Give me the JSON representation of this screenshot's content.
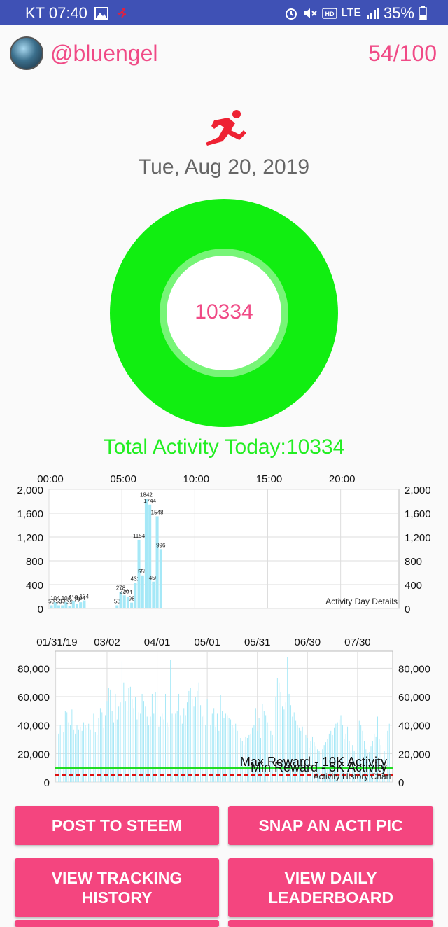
{
  "status_bar": {
    "carrier_time": "KT 07:40",
    "network": "LTE",
    "battery": "35%"
  },
  "header": {
    "username": "@bluengel",
    "score": "54/100"
  },
  "date": "Tue, Aug 20, 2019",
  "ring_value": "10334",
  "total_activity": "Total Activity Today:10334",
  "colors": {
    "accent": "#f4457f",
    "ring": "#11ee11",
    "status_bar": "#3f51b5",
    "bar": "#a5e8f7"
  },
  "chart_data": [
    {
      "type": "bar",
      "title": "Activity Day Details",
      "x_tick_labels": [
        "00:00",
        "05:00",
        "10:00",
        "15:00",
        "20:00"
      ],
      "x_ticks": [
        0,
        5,
        10,
        15,
        20
      ],
      "xlim": [
        0,
        24
      ],
      "y_ticks": [
        0,
        400,
        800,
        1200,
        1600,
        2000
      ],
      "y_tick_labels": [
        "0",
        "400",
        "800",
        "1,200",
        "1,600",
        "2,000"
      ],
      "ylim": [
        0,
        2000
      ],
      "grid": true,
      "bars": [
        {
          "x": 0.17,
          "v": 53,
          "label": "53"
        },
        {
          "x": 0.42,
          "v": 104,
          "label": "104"
        },
        {
          "x": 0.67,
          "v": 53,
          "label": "53"
        },
        {
          "x": 0.92,
          "v": 53,
          "label": "53"
        },
        {
          "x": 1.17,
          "v": 104,
          "label": "104"
        },
        {
          "x": 1.42,
          "v": 39,
          "label": "39"
        },
        {
          "x": 1.67,
          "v": 118,
          "label": "118"
        },
        {
          "x": 1.92,
          "v": 79,
          "label": "79"
        },
        {
          "x": 2.17,
          "v": 104,
          "label": "104"
        },
        {
          "x": 2.42,
          "v": 134,
          "label": "134"
        },
        {
          "x": 4.67,
          "v": 53,
          "label": "53"
        },
        {
          "x": 4.92,
          "v": 278,
          "label": "278"
        },
        {
          "x": 5.17,
          "v": 220,
          "label": "220"
        },
        {
          "x": 5.42,
          "v": 201,
          "label": "201"
        },
        {
          "x": 5.67,
          "v": 98,
          "label": "98"
        },
        {
          "x": 5.92,
          "v": 432,
          "label": "432"
        },
        {
          "x": 6.17,
          "v": 1154,
          "label": "1154"
        },
        {
          "x": 6.42,
          "v": 555,
          "label": "555"
        },
        {
          "x": 6.67,
          "v": 1842,
          "label": "1842"
        },
        {
          "x": 6.92,
          "v": 1744,
          "label": "1744"
        },
        {
          "x": 7.17,
          "v": 450,
          "label": "450"
        },
        {
          "x": 7.42,
          "v": 1548,
          "label": "1548"
        },
        {
          "x": 7.67,
          "v": 996,
          "label": "996"
        }
      ]
    },
    {
      "type": "bar",
      "title": "Activity History Chart",
      "x_tick_labels": [
        "01/31/19",
        "03/02",
        "04/01",
        "05/01",
        "05/31",
        "06/30",
        "07/30"
      ],
      "x_ticks": [
        0,
        30,
        60,
        90,
        120,
        150,
        180
      ],
      "xlim": [
        -1,
        201
      ],
      "y_ticks": [
        0,
        20000,
        40000,
        60000,
        80000
      ],
      "y_tick_labels": [
        "0",
        "20,000",
        "40,000",
        "60,000",
        "80,000"
      ],
      "ylim": [
        0,
        92000
      ],
      "grid": true,
      "lines": [
        {
          "name": "Max Reward - 10K Activity",
          "value": 10000,
          "color": "#22dd22",
          "style": "solid"
        },
        {
          "name": "Min Reward - 5K Activity",
          "value": 5000,
          "color": "#dd1111",
          "style": "dashed"
        }
      ],
      "values": [
        36000,
        34000,
        40000,
        38000,
        35000,
        50000,
        49000,
        42000,
        40000,
        51000,
        37000,
        34000,
        40000,
        37000,
        39000,
        36000,
        42000,
        40000,
        38000,
        41000,
        37000,
        39000,
        48000,
        35000,
        33000,
        45000,
        52000,
        49000,
        38000,
        47000,
        57000,
        66000,
        65000,
        50000,
        42000,
        62000,
        44000,
        53000,
        56000,
        85000,
        70000,
        57000,
        50000,
        66000,
        67000,
        58000,
        52000,
        60000,
        44000,
        49000,
        48000,
        62000,
        57000,
        53000,
        46000,
        40000,
        46000,
        62000,
        48000,
        63000,
        64000,
        39000,
        46000,
        48000,
        44000,
        62000,
        42000,
        39000,
        86000,
        48000,
        45000,
        48000,
        50000,
        62000,
        47000,
        41000,
        52000,
        47000,
        56000,
        64000,
        66000,
        58000,
        53000,
        60000,
        64000,
        70000,
        54000,
        46000,
        47000,
        40000,
        58000,
        46000,
        40000,
        48000,
        52000,
        39000,
        48000,
        36000,
        61000,
        50000,
        45000,
        48000,
        47000,
        45000,
        44000,
        40000,
        38000,
        41000,
        36000,
        34000,
        31000,
        29000,
        26000,
        32000,
        31000,
        33000,
        34000,
        38000,
        40000,
        52000,
        36000,
        45000,
        31000,
        55000,
        50000,
        47000,
        42000,
        40000,
        36000,
        33000,
        32000,
        60000,
        73000,
        70000,
        63000,
        53000,
        51000,
        56000,
        88000,
        62000,
        54000,
        46000,
        49000,
        43000,
        40000,
        38000,
        36000,
        39000,
        35000,
        33000,
        31000,
        24000,
        29000,
        32000,
        28000,
        25000,
        23000,
        22000,
        20000,
        23000,
        26000,
        28000,
        30000,
        34000,
        36000,
        33000,
        38000,
        41000,
        42000,
        44000,
        47000,
        40000,
        30000,
        34000,
        39000,
        29000,
        22000,
        26000,
        22000,
        32000,
        37000,
        43000,
        40000,
        36000,
        29000,
        23000,
        20000,
        21000,
        25000,
        29000,
        34000,
        32000,
        46000,
        30000,
        26000,
        16000,
        22000,
        34000,
        36000,
        41000
      ]
    }
  ],
  "buttons": {
    "post": "POST TO STEEM",
    "snap": "SNAP AN ACTI PIC",
    "tracking": "VIEW TRACKING HISTORY",
    "leaderboard": "VIEW DAILY LEADERBOARD"
  }
}
